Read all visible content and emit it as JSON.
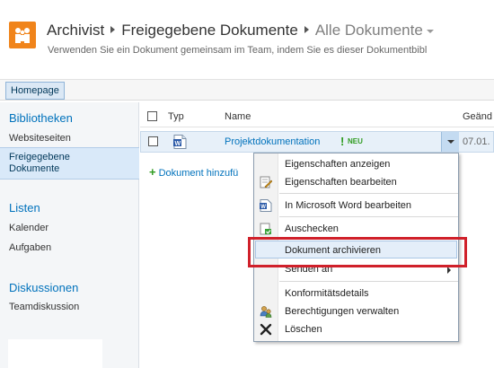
{
  "header": {
    "breadcrumb": [
      "Archivist",
      "Freigegebene Dokumente",
      "Alle Dokumente"
    ],
    "subtitle": "Verwenden Sie ein Dokument gemeinsam im Team, indem Sie es dieser Dokumentbibl"
  },
  "topnav": {
    "home_tab": "Homepage"
  },
  "sidebar": {
    "libraries_heading": "Bibliotheken",
    "library_items": [
      "Websiteseiten",
      "Freigegebene Dokumente"
    ],
    "lists_heading": "Listen",
    "list_items": [
      "Kalender",
      "Aufgaben"
    ],
    "discussions_heading": "Diskussionen",
    "discussion_items": [
      "Teamdiskussion"
    ]
  },
  "list": {
    "columns": {
      "type": "Typ",
      "name": "Name",
      "modified": "Geänd"
    },
    "row": {
      "name": "Projektdokumentation",
      "new_marker": "!",
      "new_badge": "NEU",
      "date": "07.01."
    },
    "add_document": "Dokument hinzufü"
  },
  "context_menu": {
    "items": [
      "Eigenschaften anzeigen",
      "Eigenschaften bearbeiten",
      "In Microsoft Word bearbeiten",
      "Auschecken",
      "Dokument archivieren",
      "Senden an",
      "Konformitätsdetails",
      "Berechtigungen verwalten",
      "Löschen"
    ],
    "highlighted_index": 4
  },
  "colors": {
    "link": "#0072bc",
    "highlight_box": "#d0202a",
    "logo": "#f0841b"
  }
}
